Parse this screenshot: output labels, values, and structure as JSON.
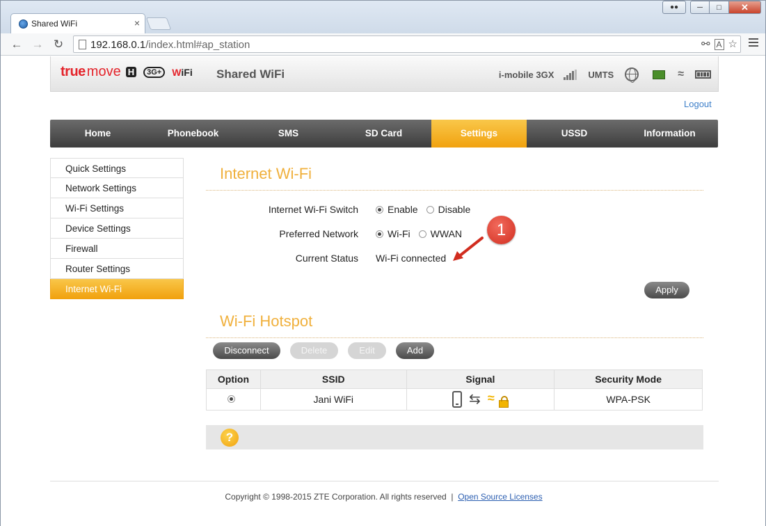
{
  "browser": {
    "tab_title": "Shared WiFi",
    "tab_close": "×",
    "url_host": "192.168.0.1",
    "url_path": "/index.html#ap_station",
    "win_close": "✕"
  },
  "header": {
    "logo_true": "true",
    "logo_move": "move",
    "logo_h": "H",
    "logo_3g": "3G+",
    "logo_wifi_w": "W",
    "logo_wifi_rest": "iFi",
    "product": "Shared WiFi",
    "operator": "i-mobile 3GX",
    "network_mode": "UMTS"
  },
  "logout": "Logout",
  "nav": [
    "Home",
    "Phonebook",
    "SMS",
    "SD Card",
    "Settings",
    "USSD",
    "Information"
  ],
  "sidebar": [
    "Quick Settings",
    "Network Settings",
    "Wi-Fi Settings",
    "Device Settings",
    "Firewall",
    "Router Settings",
    "Internet Wi-Fi"
  ],
  "internet_wifi": {
    "title": "Internet Wi-Fi",
    "switch_label": "Internet Wi-Fi Switch",
    "switch_enable": "Enable",
    "switch_disable": "Disable",
    "preferred_label": "Preferred Network",
    "preferred_wifi": "Wi-Fi",
    "preferred_wwan": "WWAN",
    "status_label": "Current Status",
    "status_value": "Wi-Fi connected",
    "apply": "Apply",
    "annotation": "1"
  },
  "hotspot": {
    "title": "Wi-Fi Hotspot",
    "btn_disconnect": "Disconnect",
    "btn_delete": "Delete",
    "btn_edit": "Edit",
    "btn_add": "Add",
    "columns": [
      "Option",
      "SSID",
      "Signal",
      "Security Mode"
    ],
    "rows": [
      {
        "ssid": "Jani WiFi",
        "security": "WPA-PSK"
      }
    ]
  },
  "help": "?",
  "footer": {
    "copyright": "Copyright © 1998-2015 ZTE Corporation. All rights reserved",
    "sep": "|",
    "link": "Open Source Licenses"
  }
}
